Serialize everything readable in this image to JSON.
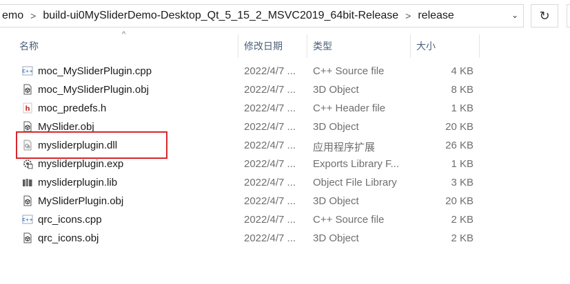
{
  "breadcrumb": [
    "emo",
    "build-ui0MySliderDemo-Desktop_Qt_5_15_2_MSVC2019_64bit-Release",
    "release"
  ],
  "columns": [
    "名称",
    "修改日期",
    "类型",
    "大小"
  ],
  "files": [
    {
      "name": "moc_MySliderPlugin.cpp",
      "date": "2022/4/7 ...",
      "type": "C++ Source file",
      "size": "4 KB",
      "icon": "cpp-source-icon"
    },
    {
      "name": "moc_MySliderPlugin.obj",
      "date": "2022/4/7 ...",
      "type": "3D Object",
      "size": "8 KB",
      "icon": "3d-object-icon"
    },
    {
      "name": "moc_predefs.h",
      "date": "2022/4/7 ...",
      "type": "C++ Header file",
      "size": "1 KB",
      "icon": "cpp-header-icon"
    },
    {
      "name": "MySlider.obj",
      "date": "2022/4/7 ...",
      "type": "3D Object",
      "size": "20 KB",
      "icon": "3d-object-icon"
    },
    {
      "name": "mysliderplugin.dll",
      "date": "2022/4/7 ...",
      "type": "应用程序扩展",
      "size": "26 KB",
      "icon": "dll-file-icon"
    },
    {
      "name": "mysliderplugin.exp",
      "date": "2022/4/7 ...",
      "type": "Exports Library F...",
      "size": "1 KB",
      "icon": "exports-library-icon"
    },
    {
      "name": "mysliderplugin.lib",
      "date": "2022/4/7 ...",
      "type": "Object File Library",
      "size": "3 KB",
      "icon": "object-library-icon"
    },
    {
      "name": "MySliderPlugin.obj",
      "date": "2022/4/7 ...",
      "type": "3D Object",
      "size": "20 KB",
      "icon": "3d-object-icon"
    },
    {
      "name": "qrc_icons.cpp",
      "date": "2022/4/7 ...",
      "type": "C++ Source file",
      "size": "2 KB",
      "icon": "cpp-source-icon"
    },
    {
      "name": "qrc_icons.obj",
      "date": "2022/4/7 ...",
      "type": "3D Object",
      "size": "2 KB",
      "icon": "3d-object-icon"
    }
  ],
  "colors": {
    "highlight": "#d6262b",
    "header_text": "#4c607a",
    "detail_text": "#6e6e6e"
  }
}
